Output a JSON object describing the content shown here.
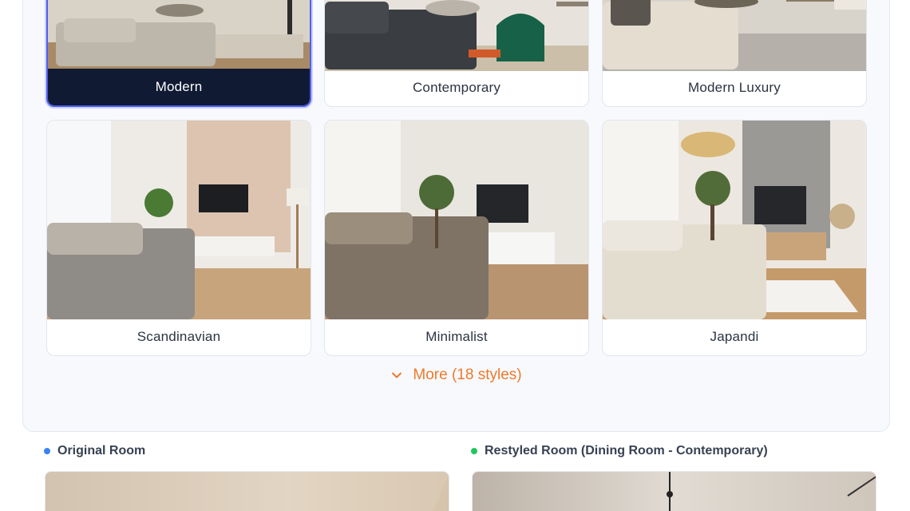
{
  "styles": [
    {
      "label": "Modern",
      "selected": true
    },
    {
      "label": "Contemporary",
      "selected": false
    },
    {
      "label": "Modern Luxury",
      "selected": false
    },
    {
      "label": "Scandinavian",
      "selected": false
    },
    {
      "label": "Minimalist",
      "selected": false
    },
    {
      "label": "Japandi",
      "selected": false
    }
  ],
  "more_button": {
    "label": "More (18 styles)",
    "icon": "chevron-down-icon"
  },
  "original_room": {
    "label": "Original Room",
    "dot_color": "#3b82f6"
  },
  "restyled_room": {
    "label": "Restyled Room (Dining Room - Contemporary)",
    "dot_color": "#22c55e"
  },
  "colors": {
    "accent": "#ee7a2c",
    "selected_border": "#4f5ff0",
    "selected_label_bg": "#101a33"
  }
}
